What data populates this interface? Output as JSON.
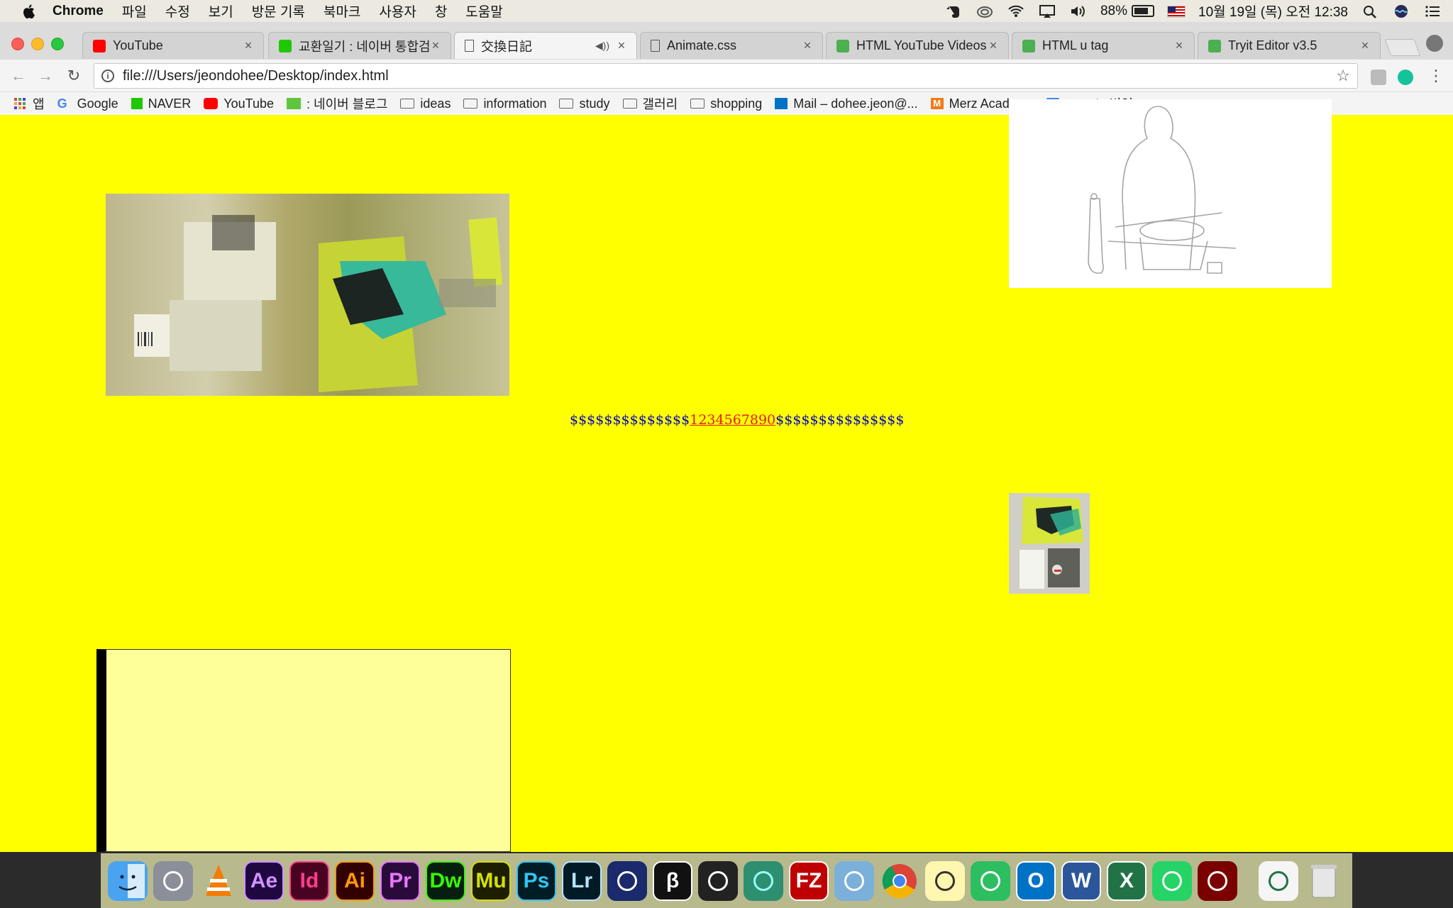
{
  "menubar": {
    "app_name": "Chrome",
    "items": [
      "파일",
      "수정",
      "보기",
      "방문 기록",
      "북마크",
      "사용자",
      "창",
      "도움말"
    ],
    "battery": "88%",
    "battery_level": 0.88,
    "datetime": "10월 19일 (목) 오전 12:38"
  },
  "tabs": [
    {
      "title": "YouTube",
      "icon": "youtube-icon",
      "color": "#ff0000"
    },
    {
      "title": "교환일기 : 네이버 통합검색",
      "icon": "naver-icon",
      "color": "#1ec800"
    },
    {
      "title": "交換日記",
      "icon": "document-icon",
      "color": "#ffffff",
      "active": true,
      "audio": true
    },
    {
      "title": "Animate.css",
      "icon": "document-icon",
      "color": "#ffffff"
    },
    {
      "title": "HTML YouTube Videos",
      "icon": "w3schools-icon",
      "color": "#4caf50"
    },
    {
      "title": "HTML u tag",
      "icon": "w3schools-icon",
      "color": "#4caf50"
    },
    {
      "title": "Tryit Editor v3.5",
      "icon": "w3schools-icon",
      "color": "#4caf50"
    }
  ],
  "toolbar": {
    "url": "file:///Users/jeondohee/Desktop/index.html"
  },
  "bookmarks": [
    {
      "label": "앱",
      "icon": "apps-grid-icon"
    },
    {
      "label": "Google",
      "icon": "google-icon"
    },
    {
      "label": "NAVER",
      "icon": "naver-icon"
    },
    {
      "label": "YouTube",
      "icon": "youtube-icon"
    },
    {
      "label": ": 네이버 블로그",
      "icon": "blog-icon"
    },
    {
      "label": "ideas",
      "icon": "folder-icon"
    },
    {
      "label": "information",
      "icon": "folder-icon"
    },
    {
      "label": "study",
      "icon": "folder-icon"
    },
    {
      "label": "갤러리",
      "icon": "folder-icon"
    },
    {
      "label": "shopping",
      "icon": "folder-icon"
    },
    {
      "label": "Mail – dohee.jeon@...",
      "icon": "outlook-icon"
    },
    {
      "label": "Merz Academy",
      "icon": "merz-icon"
    },
    {
      "label": "Google 번역",
      "icon": "google-translate-icon"
    }
  ],
  "page": {
    "background": "#ffff00",
    "dollar_prefix": "$$$$$$$$$$$$$$",
    "numbers_link": "1234567890",
    "dollar_suffix": "$$$$$$$$$$$$$$$"
  },
  "dock": [
    {
      "name": "finder-icon",
      "label": "",
      "bg": "#4aa3f0",
      "fg": "#fff"
    },
    {
      "name": "launchpad-icon",
      "label": "",
      "bg": "#8a8f99",
      "fg": "#fff"
    },
    {
      "name": "vlc-icon",
      "label": "",
      "bg": "transparent",
      "fg": "#f57c00"
    },
    {
      "name": "after-effects-icon",
      "label": "Ae",
      "bg": "#1f0740",
      "fg": "#d291ff"
    },
    {
      "name": "indesign-icon",
      "label": "Id",
      "bg": "#49021f",
      "fg": "#ff3d8b"
    },
    {
      "name": "illustrator-icon",
      "label": "Ai",
      "bg": "#330000",
      "fg": "#ff9a00"
    },
    {
      "name": "premiere-icon",
      "label": "Pr",
      "bg": "#2a0a3b",
      "fg": "#ea77ff"
    },
    {
      "name": "dreamweaver-icon",
      "label": "Dw",
      "bg": "#061e10",
      "fg": "#35fa00"
    },
    {
      "name": "muse-icon",
      "label": "Mu",
      "bg": "#1d1e00",
      "fg": "#d6e000"
    },
    {
      "name": "photoshop-icon",
      "label": "Ps",
      "bg": "#001d26",
      "fg": "#31c5f0"
    },
    {
      "name": "lightroom-icon",
      "label": "Lr",
      "bg": "#001a26",
      "fg": "#b4e4ff"
    },
    {
      "name": "cinema4d-icon",
      "label": "",
      "bg": "#1a2a6c",
      "fg": "#fff"
    },
    {
      "name": "p3-icon",
      "label": "β",
      "bg": "#111",
      "fg": "#fff"
    },
    {
      "name": "unity-icon",
      "label": "",
      "bg": "#222",
      "fg": "#fff"
    },
    {
      "name": "atom-icon",
      "label": "",
      "bg": "#2d8f6f",
      "fg": "#9ff"
    },
    {
      "name": "filezilla-icon",
      "label": "FZ",
      "bg": "#bf0000",
      "fg": "#fff"
    },
    {
      "name": "preview-icon",
      "label": "",
      "bg": "#7ab0d9",
      "fg": "#fff"
    },
    {
      "name": "chrome-icon",
      "label": "",
      "bg": "transparent",
      "fg": "#fff"
    },
    {
      "name": "notes-icon",
      "label": "",
      "bg": "#fff7b0",
      "fg": "#333"
    },
    {
      "name": "evernote-icon",
      "label": "",
      "bg": "#2dbe60",
      "fg": "#fff"
    },
    {
      "name": "outlook-icon",
      "label": "O",
      "bg": "#0072c6",
      "fg": "#fff"
    },
    {
      "name": "word-icon",
      "label": "W",
      "bg": "#2b579a",
      "fg": "#fff"
    },
    {
      "name": "excel-icon",
      "label": "X",
      "bg": "#217346",
      "fg": "#fff"
    },
    {
      "name": "whatsapp-icon",
      "label": "",
      "bg": "#25d366",
      "fg": "#fff"
    },
    {
      "name": "acrobat-icon",
      "label": "",
      "bg": "#7a0000",
      "fg": "#fff"
    },
    {
      "name": "excel-document-icon",
      "label": "",
      "bg": "#f5f5f5",
      "fg": "#217346"
    },
    {
      "name": "trash-icon",
      "label": "",
      "bg": "#e0e0e0",
      "fg": "#888"
    }
  ]
}
